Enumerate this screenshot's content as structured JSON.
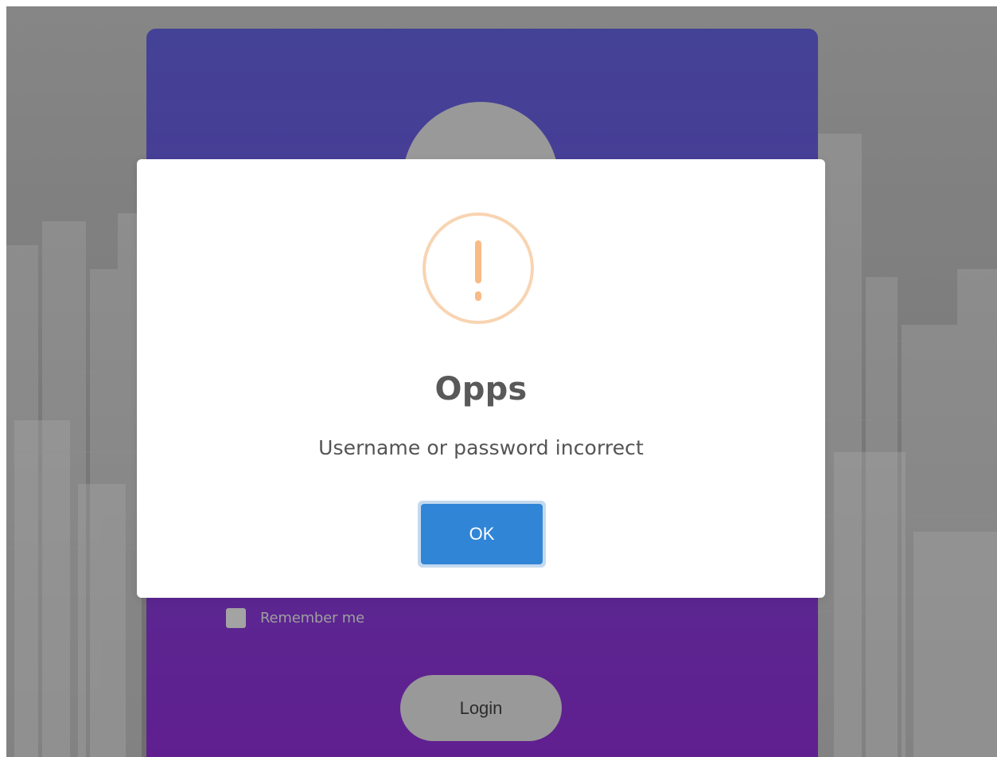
{
  "background": {
    "color": "#8a8a8a"
  },
  "login_card": {
    "gradient_top": "#45449a",
    "gradient_bottom": "#622092",
    "avatar_icon": "avatar-placeholder",
    "remember_label": "Remember me",
    "login_label": "Login"
  },
  "modal": {
    "icon": "warning-icon",
    "icon_color": "#f8bb86",
    "title": "Opps",
    "message": "Username or password incorrect",
    "ok_label": "OK",
    "ok_color": "#3085d6"
  }
}
